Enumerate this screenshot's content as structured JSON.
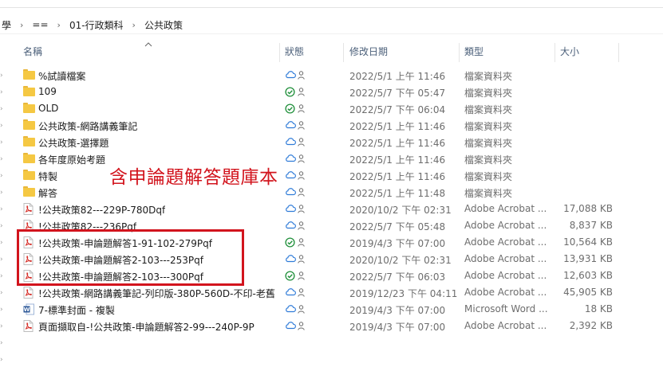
{
  "breadcrumb": {
    "items": [
      "學",
      "==",
      "01-行政類科",
      "公共政策"
    ],
    "separator": "›"
  },
  "columns": {
    "name": "名稱",
    "status": "狀態",
    "modified": "修改日期",
    "type": "類型",
    "size": "大小"
  },
  "files": [
    {
      "name": "%試讀檔案",
      "kind": "folder",
      "status": "cloud",
      "modified": "2022/5/1 上午 11:46",
      "type": "檔案資料夾",
      "size": ""
    },
    {
      "name": "109",
      "kind": "folder",
      "status": "synced",
      "modified": "2022/5/7 下午 05:47",
      "type": "檔案資料夾",
      "size": ""
    },
    {
      "name": "OLD",
      "kind": "folder",
      "status": "synced",
      "modified": "2022/5/7 下午 06:04",
      "type": "檔案資料夾",
      "size": ""
    },
    {
      "name": "公共政策-網路講義筆記",
      "kind": "folder",
      "status": "cloud",
      "modified": "2022/5/1 上午 11:46",
      "type": "檔案資料夾",
      "size": ""
    },
    {
      "name": "公共政策-選擇題",
      "kind": "folder",
      "status": "cloud",
      "modified": "2022/5/1 上午 11:46",
      "type": "檔案資料夾",
      "size": ""
    },
    {
      "name": "各年度原始考題",
      "kind": "folder",
      "status": "cloud",
      "modified": "2022/5/1 上午 11:46",
      "type": "檔案資料夾",
      "size": ""
    },
    {
      "name": "特製",
      "kind": "folder",
      "status": "cloud",
      "modified": "2022/5/1 上午 11:46",
      "type": "檔案資料夾",
      "size": ""
    },
    {
      "name": "解答",
      "kind": "folder",
      "status": "cloud",
      "modified": "2022/5/1 上午 11:48",
      "type": "檔案資料夾",
      "size": ""
    },
    {
      "name": "!公共政策82---229P-780Dqf",
      "kind": "pdf",
      "status": "cloud",
      "modified": "2020/10/2 下午 02:31",
      "type": "Adobe Acrobat ...",
      "size": "17,088 KB"
    },
    {
      "name": "!公共政策82---236Pqf",
      "kind": "pdf",
      "status": "cloud",
      "modified": "2022/5/7 下午 05:48",
      "type": "Adobe Acrobat ...",
      "size": "8,837 KB"
    },
    {
      "name": "!公共政策-申論題解答1-91-102-279Pqf",
      "kind": "pdf",
      "status": "synced",
      "modified": "2019/4/3 下午 07:00",
      "type": "Adobe Acrobat ...",
      "size": "10,564 KB"
    },
    {
      "name": "!公共政策-申論題解答2-103---253Pqf",
      "kind": "pdf",
      "status": "cloud",
      "modified": "2020/10/2 下午 02:31",
      "type": "Adobe Acrobat ...",
      "size": "13,931 KB"
    },
    {
      "name": "!公共政策-申論題解答2-103---300Pqf",
      "kind": "pdf",
      "status": "synced",
      "modified": "2022/5/7 下午 06:03",
      "type": "Adobe Acrobat ...",
      "size": "12,603 KB"
    },
    {
      "name": "!公共政策-網路講義筆記-列印版-380P-560D-不印-老舊",
      "kind": "pdf",
      "status": "cloud",
      "modified": "2019/12/23 下午 04:11",
      "type": "Adobe Acrobat ...",
      "size": "45,905 KB"
    },
    {
      "name": "7-標準封面 - 複製",
      "kind": "word",
      "status": "cloud",
      "modified": "2019/4/3 下午 07:00",
      "type": "Microsoft Word ...",
      "size": "18 KB"
    },
    {
      "name": "頁面擷取自-!公共政策-申論題解答2-99---240P-9P",
      "kind": "pdf",
      "status": "cloud",
      "modified": "2019/4/3 下午 07:00",
      "type": "Adobe Acrobat ...",
      "size": "2,392 KB"
    }
  ],
  "annotation": {
    "text": "含申論題解答題庫本",
    "color": "#d2141d"
  },
  "colors": {
    "folder": "#f5c843",
    "pdf_red": "#d6302a",
    "word_blue": "#2b5797",
    "cloud_blue": "#2f7bd8",
    "synced_green": "#1f8f3a",
    "header_text": "#4c607a"
  }
}
